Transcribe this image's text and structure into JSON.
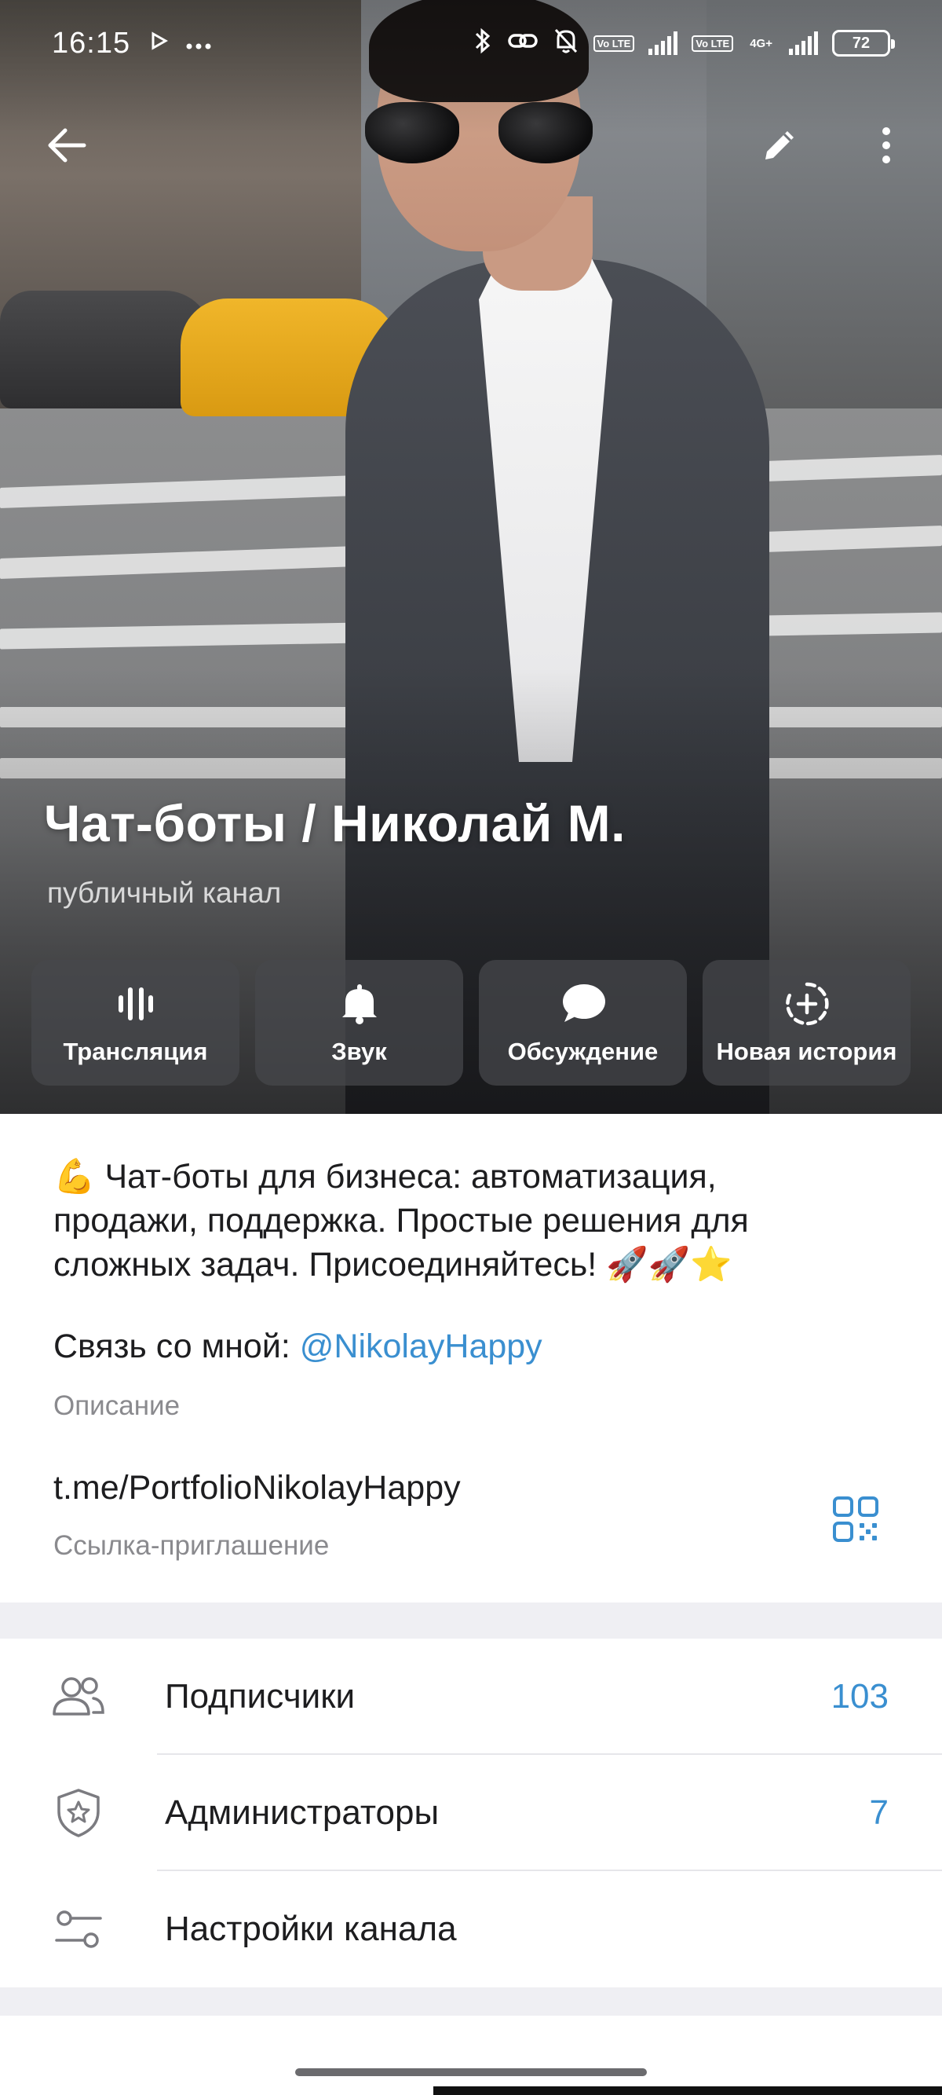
{
  "status_bar": {
    "time": "16:15",
    "left_icons": [
      "play-icon",
      "more-dots-icon"
    ],
    "battery": "72",
    "network_labels": [
      "Vo LTE",
      "Vo LTE",
      "4G+"
    ]
  },
  "header": {
    "title": "Чат-боты / Николай М.",
    "subtitle": "публичный канал"
  },
  "actions": [
    {
      "label": "Трансляция",
      "icon": "live-stream-icon"
    },
    {
      "label": "Звук",
      "icon": "bell-icon"
    },
    {
      "label": "Обсуждение",
      "icon": "chat-bubble-icon"
    },
    {
      "label": "Новая история",
      "icon": "add-story-icon"
    }
  ],
  "info": {
    "description": "💪 Чат-боты для бизнеса: автоматизация, продажи, поддержка. Простые решения для сложных задач. Присоединяйтесь! 🚀🚀⭐",
    "contact_prefix": "Связь со мной: ",
    "contact_mention": "@NikolayHappy",
    "description_caption": "Описание",
    "link": "t.me/PortfolioNikolayHappy",
    "link_caption": "Ссылка-приглашение"
  },
  "menu": [
    {
      "label": "Подписчики",
      "value": "103",
      "icon": "subscribers-icon"
    },
    {
      "label": "Администраторы",
      "value": "7",
      "icon": "admin-shield-icon"
    },
    {
      "label": "Настройки канала",
      "value": "",
      "icon": "settings-sliders-icon"
    }
  ],
  "colors": {
    "accent": "#3a8fd0",
    "card_bg": "#ffffff",
    "page_bg": "#efeff3"
  }
}
